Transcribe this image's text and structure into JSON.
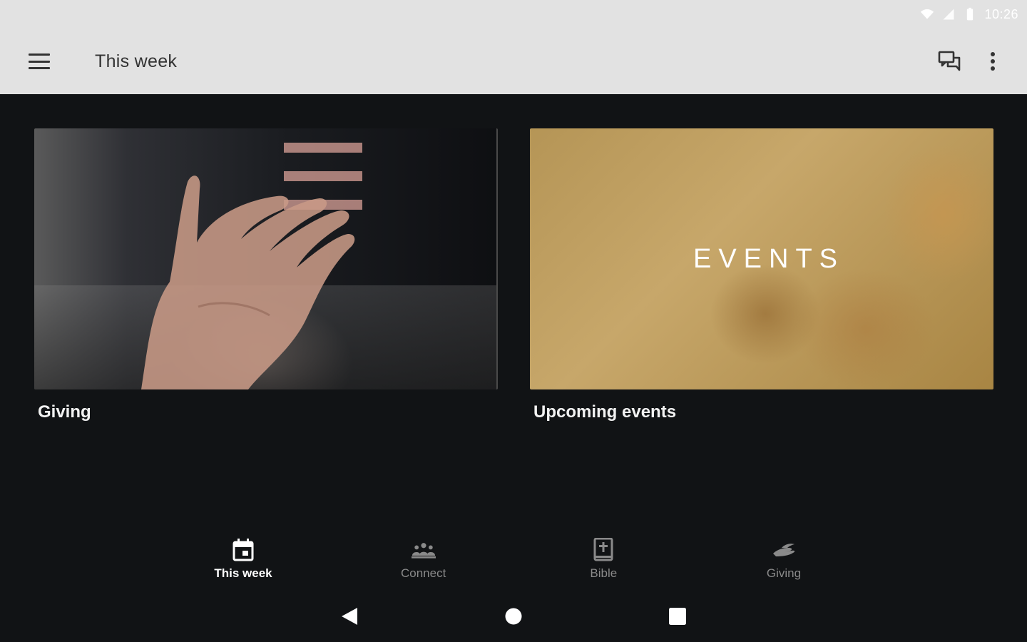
{
  "status_bar": {
    "time": "10:26",
    "icons": [
      "wifi-icon",
      "signal-icon",
      "battery-icon"
    ]
  },
  "app_bar": {
    "title": "This week",
    "menu_icon": "hamburger-menu-icon",
    "actions": [
      "chat-icon",
      "more-vertical-icon"
    ]
  },
  "cards": [
    {
      "title": "Giving",
      "image_label": ""
    },
    {
      "title": "Upcoming events",
      "image_label": "EVENTS"
    }
  ],
  "bottom_nav": {
    "items": [
      {
        "label": "This week",
        "icon": "calendar-icon",
        "active": true
      },
      {
        "label": "Connect",
        "icon": "group-icon",
        "active": false
      },
      {
        "label": "Bible",
        "icon": "bible-icon",
        "active": false
      },
      {
        "label": "Giving",
        "icon": "giving-hand-icon",
        "active": false
      }
    ]
  },
  "system_nav": [
    "back-icon",
    "home-icon",
    "recents-icon"
  ],
  "colors": {
    "background": "#111315",
    "app_bar": "#e2e2e2",
    "events_overlay": "#b59556",
    "nav_inactive": "#8a8a8a",
    "nav_active": "#ffffff"
  }
}
